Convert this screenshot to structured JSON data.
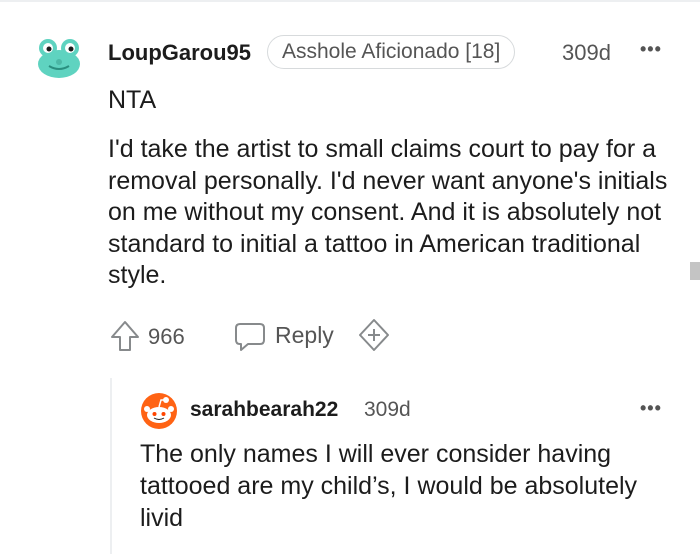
{
  "comment": {
    "username": "LoupGarou95",
    "flair": "Asshole Aficionado [18]",
    "time": "309d",
    "more": "•••",
    "verdict": "NTA",
    "body": "I'd take the artist to small claims court to pay for a removal personally. I'd never want anyone's initials on me without my consent. And it is absolutely not standard to initial a tattoo in American traditional style.",
    "upvotes": "966",
    "reply_label": "Reply"
  },
  "reply": {
    "username": "sarahbearah22",
    "time": "309d",
    "more": "•••",
    "body": "The only names I will ever consider having tattooed are my child’s, I would be absolutely livid"
  },
  "colors": {
    "avatar_main": "#5fd3c0",
    "avatar_reply": "#ff6314",
    "meta_text": "#555555",
    "border": "#d7dadc"
  },
  "icons": [
    "frog-avatar-icon",
    "upvote-arrow-icon",
    "reply-bubble-icon",
    "add-award-icon",
    "snoo-avatar-icon",
    "more-options-icon"
  ]
}
